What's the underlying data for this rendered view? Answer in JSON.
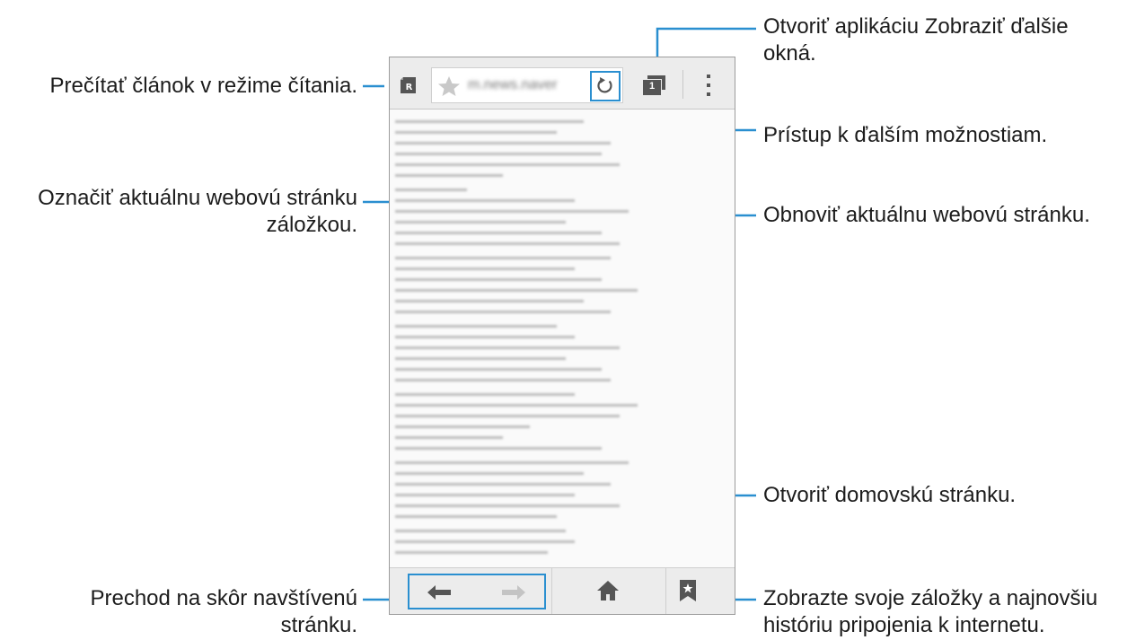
{
  "callouts": {
    "reader": [
      "Prečítať článok v režime čítania."
    ],
    "bookmark_add": [
      "Označiť aktuálnu webovú stránku",
      "záložkou."
    ],
    "back": [
      "Prechod na skôr navštívenú",
      "stránku."
    ],
    "windows": [
      "Otvoriť aplikáciu Zobraziť ďalšie",
      "okná."
    ],
    "more": [
      "Prístup k ďalším možnostiam."
    ],
    "refresh": [
      "Obnoviť aktuálnu webovú stránku."
    ],
    "home": [
      "Otvoriť domovskú stránku."
    ],
    "bookmarks": [
      "Zobrazte svoje záložky a najnovšiu",
      "históriu pripojenia k internetu."
    ]
  },
  "browser": {
    "url": "m.news.naver",
    "windows_count": "1",
    "icons": {
      "reader": "reader-mode-icon",
      "star": "bookmark-star-icon",
      "refresh": "refresh-icon",
      "windows": "windows-icon",
      "more": "more-options-icon",
      "back": "back-arrow-icon",
      "forward": "forward-arrow-icon",
      "home": "home-icon",
      "bookmarks": "bookmarks-icon"
    }
  },
  "colors": {
    "accent": "#2a8fd0",
    "toolbar_bg": "#ececec",
    "icon": "#555555"
  }
}
